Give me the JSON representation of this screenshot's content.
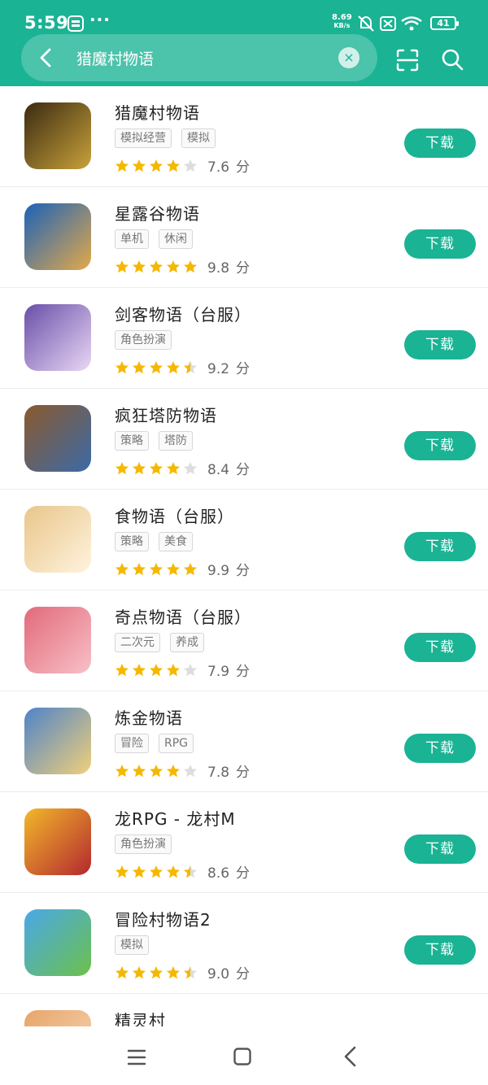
{
  "status": {
    "time": "5:59",
    "speed_value": "8.69",
    "speed_unit": "KB/s",
    "battery": "41"
  },
  "search": {
    "query": "猎魔村物语",
    "clear_symbol": "×"
  },
  "download_label": "下载",
  "score_unit": "分",
  "apps": [
    {
      "name": "猎魔村物语",
      "tags": [
        "模拟经营",
        "模拟"
      ],
      "stars": 4,
      "score": "7.6",
      "colors": [
        "#3a2a12",
        "#c9a23a"
      ]
    },
    {
      "name": "星露谷物语",
      "tags": [
        "单机",
        "休闲"
      ],
      "stars": 5,
      "score": "9.8",
      "colors": [
        "#1b62b8",
        "#e3a94a"
      ]
    },
    {
      "name": "剑客物语（台服）",
      "tags": [
        "角色扮演"
      ],
      "stars": 4.5,
      "score": "9.2",
      "colors": [
        "#6a4fa8",
        "#e9d7f5"
      ]
    },
    {
      "name": "疯狂塔防物语",
      "tags": [
        "策略",
        "塔防"
      ],
      "stars": 4,
      "score": "8.4",
      "colors": [
        "#8a5a2e",
        "#3c6aa8"
      ]
    },
    {
      "name": "食物语（台服）",
      "tags": [
        "策略",
        "美食"
      ],
      "stars": 5,
      "score": "9.9",
      "colors": [
        "#e8c68a",
        "#fff3de"
      ]
    },
    {
      "name": "奇点物语（台服）",
      "tags": [
        "二次元",
        "养成"
      ],
      "stars": 4,
      "score": "7.9",
      "colors": [
        "#e26a7a",
        "#f7c0c8"
      ]
    },
    {
      "name": "炼金物语",
      "tags": [
        "冒险",
        "RPG"
      ],
      "stars": 4,
      "score": "7.8",
      "colors": [
        "#4f83c9",
        "#f0d07a"
      ]
    },
    {
      "name": "龙RPG - 龙村M",
      "tags": [
        "角色扮演"
      ],
      "stars": 4.5,
      "score": "8.6",
      "colors": [
        "#f2b82a",
        "#b3282f"
      ]
    },
    {
      "name": "冒险村物语2",
      "tags": [
        "模拟"
      ],
      "stars": 4.5,
      "score": "9.0",
      "colors": [
        "#4aa8e8",
        "#6cc04a"
      ]
    }
  ],
  "partial_app": {
    "name": "精灵村"
  },
  "icons": {
    "back": "back-arrow-icon",
    "clear": "clear-icon",
    "scan": "scan-icon",
    "search": "search-icon",
    "star_full": "star-icon",
    "nav_menu": "menu-icon",
    "nav_home": "home-icon",
    "nav_back": "back-icon"
  },
  "colors": {
    "accent": "#1ab394",
    "star": "#f5b800",
    "star_empty": "#dddddd"
  }
}
